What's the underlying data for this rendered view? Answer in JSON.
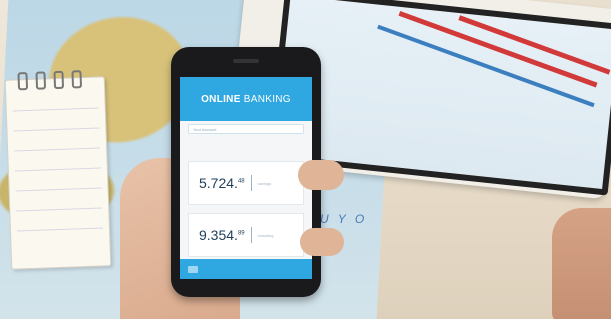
{
  "banking_app": {
    "title_bold": "ONLINE",
    "title_rest": " BANKING",
    "account_bar_label": "Your Account",
    "balance_1": {
      "main": "5.724.",
      "cents": "48",
      "label": "savings"
    },
    "balance_2": {
      "main": "9.354.",
      "cents": "89",
      "label": "checking"
    }
  },
  "map_text": "U Y O",
  "colors": {
    "app_blue": "#2fa7e0",
    "tablet_red": "#d23a3a",
    "tablet_blue": "#3b7fc0"
  }
}
